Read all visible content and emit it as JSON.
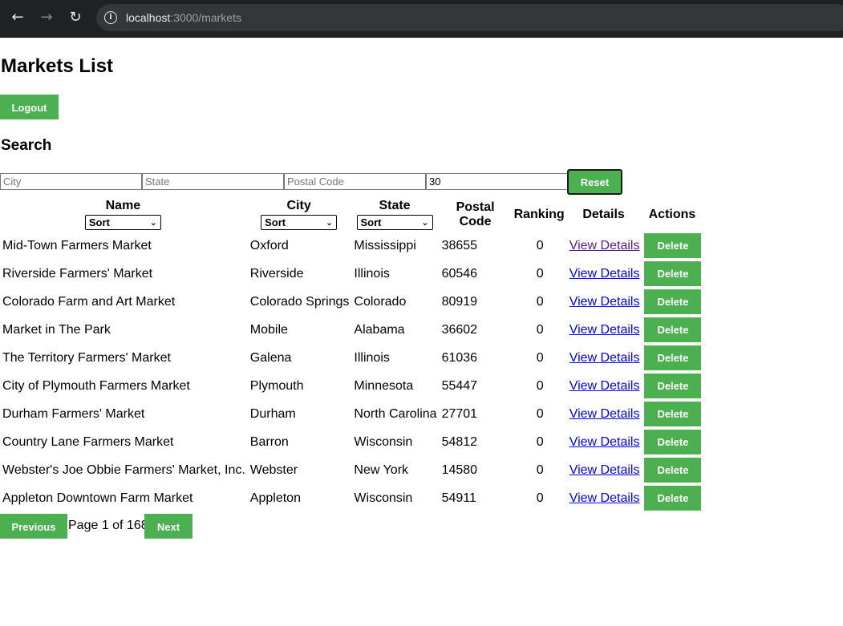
{
  "browser": {
    "url_host": "localhost",
    "url_path": ":3000/markets"
  },
  "page": {
    "title": "Markets List",
    "logout_label": "Logout",
    "search_title": "Search"
  },
  "filters": {
    "city_placeholder": "City",
    "state_placeholder": "State",
    "postal_placeholder": "Postal Code",
    "ranking_value": "30",
    "reset_label": "Reset"
  },
  "table": {
    "headers": {
      "name": "Name",
      "city": "City",
      "state": "State",
      "postal": "Postal Code",
      "ranking": "Ranking",
      "details": "Details",
      "actions": "Actions"
    },
    "sort_label": "Sort",
    "rows": [
      {
        "name": "Mid-Town Farmers Market",
        "city": "Oxford",
        "state": "Mississippi",
        "postal": "38655",
        "ranking": "0",
        "details": "View Details",
        "delete": "Delete"
      },
      {
        "name": "Riverside Farmers' Market",
        "city": "Riverside",
        "state": "Illinois",
        "postal": "60546",
        "ranking": "0",
        "details": "View Details",
        "delete": "Delete"
      },
      {
        "name": "Colorado Farm and Art Market",
        "city": "Colorado Springs",
        "state": "Colorado",
        "postal": "80919",
        "ranking": "0",
        "details": "View Details",
        "delete": "Delete"
      },
      {
        "name": "Market in The Park",
        "city": "Mobile",
        "state": "Alabama",
        "postal": "36602",
        "ranking": "0",
        "details": "View Details",
        "delete": "Delete"
      },
      {
        "name": "The Territory Farmers' Market",
        "city": "Galena",
        "state": "Illinois",
        "postal": "61036",
        "ranking": "0",
        "details": "View Details",
        "delete": "Delete"
      },
      {
        "name": "City of Plymouth Farmers Market",
        "city": "Plymouth",
        "state": "Minnesota",
        "postal": "55447",
        "ranking": "0",
        "details": "View Details",
        "delete": "Delete"
      },
      {
        "name": "Durham Farmers' Market",
        "city": "Durham",
        "state": "North Carolina",
        "postal": "27701",
        "ranking": "0",
        "details": "View Details",
        "delete": "Delete"
      },
      {
        "name": "Country Lane Farmers Market",
        "city": "Barron",
        "state": "Wisconsin",
        "postal": "54812",
        "ranking": "0",
        "details": "View Details",
        "delete": "Delete"
      },
      {
        "name": "Webster's Joe Obbie Farmers' Market, Inc.",
        "city": "Webster",
        "state": "New York",
        "postal": "14580",
        "ranking": "0",
        "details": "View Details",
        "delete": "Delete"
      },
      {
        "name": "Appleton Downtown Farm Market",
        "city": "Appleton",
        "state": "Wisconsin",
        "postal": "54911",
        "ranking": "0",
        "details": "View Details",
        "delete": "Delete"
      }
    ]
  },
  "pagination": {
    "previous_label": "Previous",
    "page_info": "Page 1 of 168",
    "next_label": "Next"
  },
  "icons": {
    "back": "back-arrow-icon",
    "forward": "forward-arrow-icon",
    "reload": "reload-icon",
    "site_info": "info-icon",
    "dropdown": "chevron-down-icon"
  }
}
